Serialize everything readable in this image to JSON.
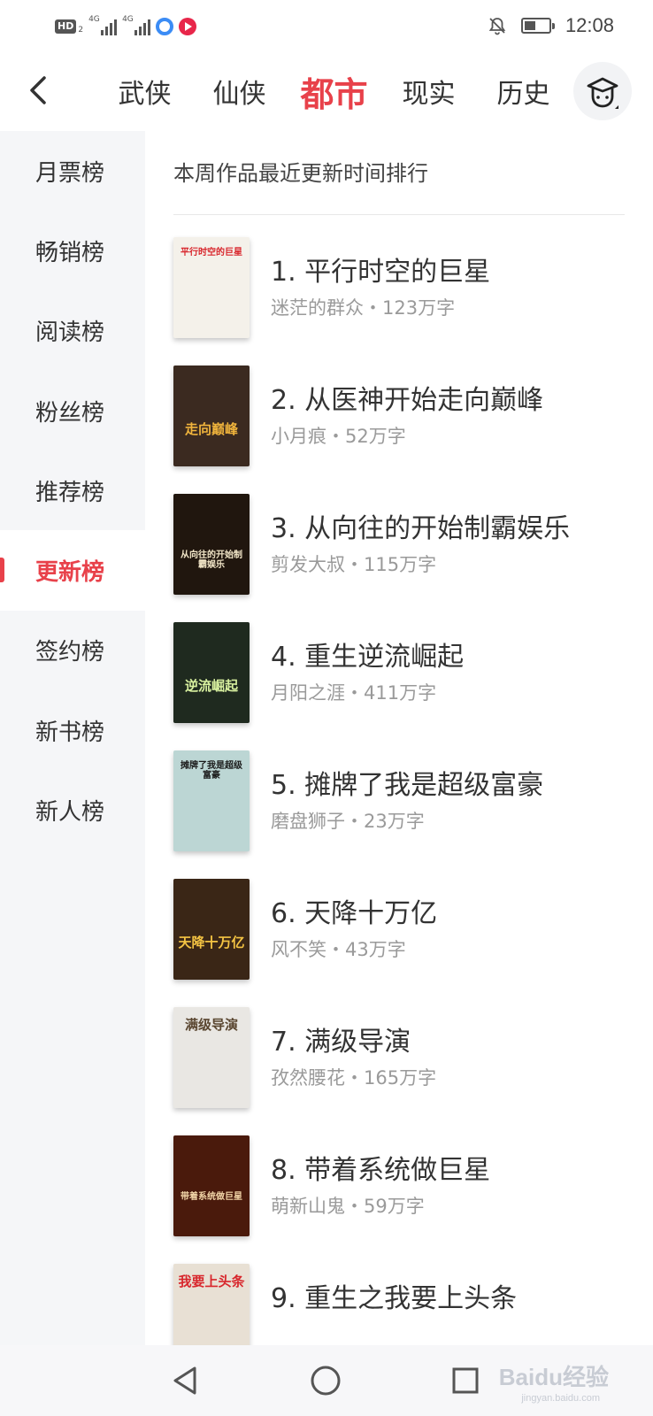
{
  "status_bar": {
    "hd": "HD",
    "hd_sub": "2",
    "network1": "4G",
    "network2": "4G",
    "time": "12:08",
    "battery_level": 0.45
  },
  "header": {
    "tabs": [
      {
        "label": "武侠",
        "active": false
      },
      {
        "label": "仙侠",
        "active": false
      },
      {
        "label": "都市",
        "active": true
      },
      {
        "label": "现实",
        "active": false
      },
      {
        "label": "历史",
        "active": false
      }
    ]
  },
  "sidebar": {
    "items": [
      {
        "label": "月票榜"
      },
      {
        "label": "畅销榜"
      },
      {
        "label": "阅读榜"
      },
      {
        "label": "粉丝榜"
      },
      {
        "label": "推荐榜"
      },
      {
        "label": "更新榜",
        "active": true
      },
      {
        "label": "签约榜"
      },
      {
        "label": "新书榜"
      },
      {
        "label": "新人榜"
      }
    ]
  },
  "main": {
    "section_title": "本周作品最近更新时间排行",
    "books": [
      {
        "title": "1. 平行时空的巨星",
        "meta": "迷茫的群众・123万字",
        "cover_text": "平行时空的巨星",
        "cover_color": "#f4f1ea",
        "cover_text_color": "#d8262c"
      },
      {
        "title": "2. 从医神开始走向巅峰",
        "meta": "小月痕・52万字",
        "cover_text": "走向巅峰",
        "cover_color": "#3b2a20",
        "cover_text_color": "#f0b43c"
      },
      {
        "title": "3. 从向往的开始制霸娱乐",
        "meta": "剪发大叔・115万字",
        "cover_text": "从向往的开始制霸娱乐",
        "cover_color": "#20160e",
        "cover_text_color": "#f2e6c8"
      },
      {
        "title": "4. 重生逆流崛起",
        "meta": "月阳之涯・411万字",
        "cover_text": "逆流崛起",
        "cover_color": "#1f2a1f",
        "cover_text_color": "#d9f2a0"
      },
      {
        "title": "5. 摊牌了我是超级富豪",
        "meta": "磨盘狮子・23万字",
        "cover_text": "摊牌了我是超级富豪",
        "cover_color": "#bcd6d4",
        "cover_text_color": "#1a1a1a"
      },
      {
        "title": "6. 天降十万亿",
        "meta": "风不笑・43万字",
        "cover_text": "天降十万亿",
        "cover_color": "#3a2616",
        "cover_text_color": "#f5c443"
      },
      {
        "title": "7. 满级导演",
        "meta": "孜然腰花・165万字",
        "cover_text": "满级导演",
        "cover_color": "#e9e7e3",
        "cover_text_color": "#5a4630"
      },
      {
        "title": "8. 带着系统做巨星",
        "meta": "萌新山鬼・59万字",
        "cover_text": "带着系统做巨星",
        "cover_color": "#4a1a0c",
        "cover_text_color": "#f2d6a8"
      },
      {
        "title": "9. 重生之我要上头条",
        "meta": "",
        "cover_text": "我要上头条",
        "cover_color": "#e8e0d4",
        "cover_text_color": "#d8262c"
      }
    ]
  },
  "navbar": {
    "watermark": "Baidu经验",
    "watermark_sub": "jingyan.baidu.com"
  }
}
